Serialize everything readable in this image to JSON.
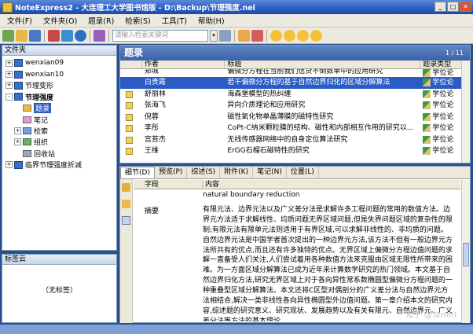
{
  "window": {
    "title": "NoteExpress2 - 大连理工大学图书馆版 - D:\\Backup\\节理强度.nel"
  },
  "menu": [
    {
      "label": "文件(F)"
    },
    {
      "label": "文件夹(O)"
    },
    {
      "label": "题录(R)"
    },
    {
      "label": "检索(S)"
    },
    {
      "label": "工具(T)"
    },
    {
      "label": "帮助(H)"
    }
  ],
  "toolbar": {
    "search_placeholder": "请输入检索关键词"
  },
  "folders": {
    "header": "文件夹",
    "items": [
      {
        "label": "wenxian09",
        "level": 0,
        "expander": "+",
        "icon": "book-icon"
      },
      {
        "label": "wenxian10",
        "level": 0,
        "expander": "+",
        "icon": "book-icon"
      },
      {
        "label": "节理变形",
        "level": 0,
        "expander": "+",
        "icon": "book-icon"
      },
      {
        "label": "节理强度",
        "level": 0,
        "expander": "-",
        "icon": "book-icon",
        "bold": true
      },
      {
        "label": "题录",
        "level": 1,
        "expander": "",
        "icon": "folder-icon",
        "selected": true
      },
      {
        "label": "笔记",
        "level": 1,
        "expander": "",
        "icon": "folder-icon"
      },
      {
        "label": "检索",
        "level": 1,
        "expander": "+",
        "icon": "folder-icon"
      },
      {
        "label": "组织",
        "level": 1,
        "expander": "+",
        "icon": "folder-icon"
      },
      {
        "label": "回收站",
        "level": 1,
        "expander": "",
        "icon": "folder-icon"
      },
      {
        "label": "临界节理强度折减",
        "level": 0,
        "expander": "+",
        "icon": "book-icon"
      }
    ]
  },
  "tags": {
    "header": "标签云",
    "empty": "（无标签）"
  },
  "records": {
    "header": "题录",
    "pager": "1 / 11",
    "columns": [
      "",
      "作者",
      "标题",
      "题录类型"
    ],
    "rows": [
      {
        "author": "郑城",
        "title": "偏微分方程在当前我们信贷不倒数单中的应用研究",
        "type": "学位论"
      },
      {
        "author": "白贵霞",
        "title": "若干偏微分方程的基于自然边界归化的区域分解算法",
        "type": "学位论",
        "selected": true
      },
      {
        "author": "舒丽林",
        "title": "海森堡模型的热纠缠",
        "type": "学位论"
      },
      {
        "author": "张海飞",
        "title": "异向介质理论和应用研究",
        "type": "学位论"
      },
      {
        "author": "倪蓉",
        "title": "磁性氧化物单晶薄膜的磁特性研究",
        "type": "学位论"
      },
      {
        "author": "李彤",
        "title": "CoPt-C纳米颗粒膜的结构、磁性和内部相互作用的研究以...",
        "type": "学位论"
      },
      {
        "author": "宫苔杰",
        "title": "无线传感器网络中的自身定位算法研究",
        "type": "学位论"
      },
      {
        "author": "王维",
        "title": "ErGG石榴石磁特性的研究",
        "type": "学位论"
      }
    ]
  },
  "detail": {
    "tabs": [
      "细节(D)",
      "预览(P)",
      "综述(S)",
      "附件(K)",
      "笔记(N)",
      "位置(L)"
    ],
    "col_field": "字段",
    "col_content": "内容",
    "rows": [
      {
        "field": "",
        "value": "natural boundary reduction"
      },
      {
        "field": "摘要",
        "value": "有限元法、边界元法以及广义差分法是求解许多工程问题的常用的数值方法。边界元方法适于求解线性、均质问题无界区域问题,但是失界问题区域的复杂性的限制;有限元法有限单元法则适用于有界区域,可以求解非线性的、非均质的问题。自然边界元法是中国学者首次提出的一种边界元方法,该方法不但有一般边界元方法所共有的优点,而且还有许多独特的优点。无界区域上偏微分方程边值问题的求解一直备受人们关注,人们尝试着用各种数值方法来克服由区域无限性所带来的困难。为一方面区域分解算法已成为近年来计算数学研究的热门领域。本文基于自然边界归化方法,研究无界区域上对于各向异性常系数椭圆型偏微分方程问题的一种重叠型区域分解算法。本文还将C区型对偶剖分的广义差分法与自然边界元方法相结合,解决一类非线性各向异性椭圆型外边值问题。第一章介绍本文的研究内容,综述题的研究意义、研究现状、发展趋势以及有关有限元、自然边界元、广义差分法等方法的基本理论。"
      }
    ]
  },
  "watermark": "知乎 @Tarrett"
}
